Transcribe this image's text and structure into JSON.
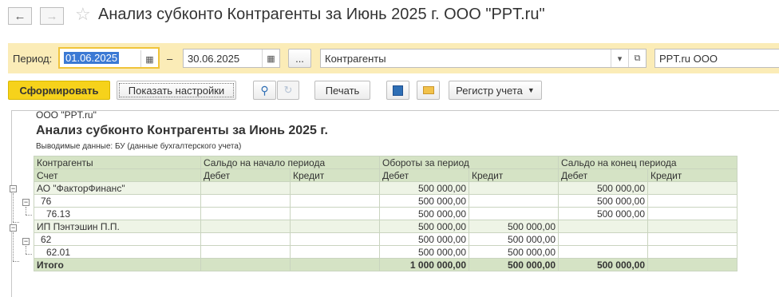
{
  "window": {
    "title": "Анализ субконто Контрагенты за Июнь 2025 г. ООО \"PPT.ru\""
  },
  "filters": {
    "period_label": "Период:",
    "date_from": "01.06.2025",
    "dash": "–",
    "date_to": "30.06.2025",
    "ellipsis": "...",
    "subconto": "Контрагенты",
    "organization": "PPT.ru ООО"
  },
  "toolbar": {
    "generate": "Сформировать",
    "show_settings": "Показать настройки",
    "print": "Печать",
    "register": "Регистр учета"
  },
  "report": {
    "org": "ООО \"PPT.ru\"",
    "heading": "Анализ субконто Контрагенты за Июнь 2025 г.",
    "subtitle": "Выводимые данные:  БУ (данные бухгалтерского учета)",
    "headers": {
      "col1_top": "Контрагенты",
      "col1_bottom": "Счет",
      "opening": "Сальдо на начало периода",
      "turnover": "Обороты за период",
      "closing": "Сальдо на конец периода",
      "debit": "Дебет",
      "credit": "Кредит"
    },
    "rows": [
      {
        "name": "АО \"ФакторФинанс\"",
        "level": 0,
        "od": "",
        "oc": "",
        "td": "500 000,00",
        "tc": "",
        "cd": "500 000,00",
        "cc": ""
      },
      {
        "name": "76",
        "level": 1,
        "od": "",
        "oc": "",
        "td": "500 000,00",
        "tc": "",
        "cd": "500 000,00",
        "cc": ""
      },
      {
        "name": "76.13",
        "level": 2,
        "od": "",
        "oc": "",
        "td": "500 000,00",
        "tc": "",
        "cd": "500 000,00",
        "cc": ""
      },
      {
        "name": "ИП Пэнтэшин П.П.",
        "level": 0,
        "od": "",
        "oc": "",
        "td": "500 000,00",
        "tc": "500 000,00",
        "cd": "",
        "cc": ""
      },
      {
        "name": "62",
        "level": 1,
        "od": "",
        "oc": "",
        "td": "500 000,00",
        "tc": "500 000,00",
        "cd": "",
        "cc": ""
      },
      {
        "name": "62.01",
        "level": 2,
        "od": "",
        "oc": "",
        "td": "500 000,00",
        "tc": "500 000,00",
        "cd": "",
        "cc": ""
      }
    ],
    "total": {
      "name": "Итого",
      "od": "",
      "oc": "",
      "td": "1 000 000,00",
      "tc": "500 000,00",
      "cd": "500 000,00",
      "cc": ""
    }
  }
}
